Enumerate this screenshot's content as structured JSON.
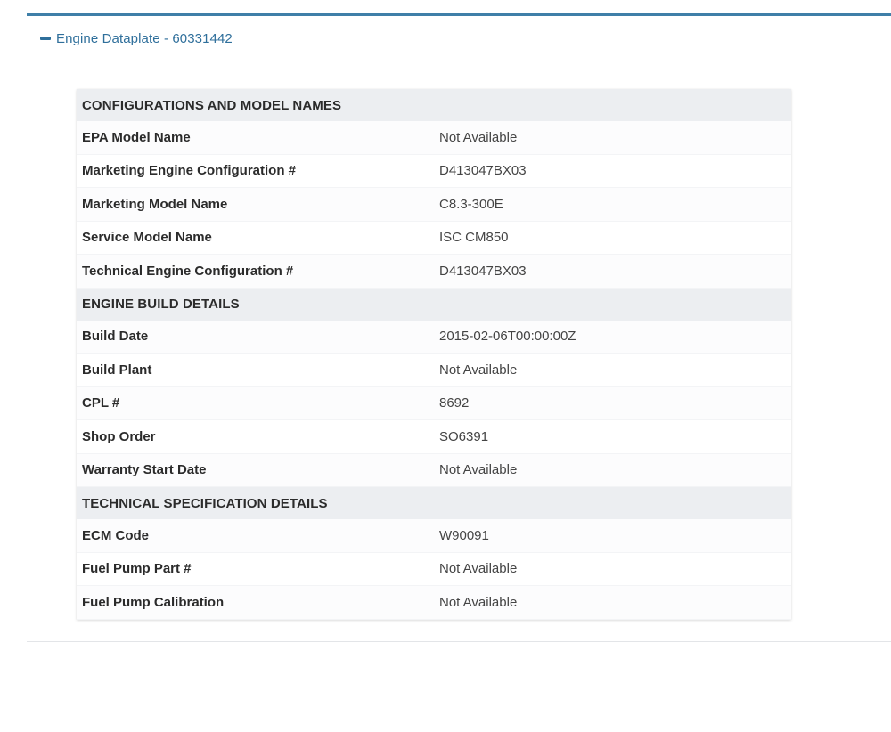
{
  "panel": {
    "title": "Engine Dataplate - 60331442",
    "collapse_icon": "minus-icon"
  },
  "colors": {
    "accent": "#3f7fa8",
    "link": "#2f6f9b",
    "section_bg": "#eceef1"
  },
  "sections": [
    {
      "title": "CONFIGURATIONS AND MODEL NAMES",
      "rows": [
        {
          "label": "EPA Model Name",
          "value": "Not Available"
        },
        {
          "label": "Marketing Engine Configuration #",
          "value": "D413047BX03"
        },
        {
          "label": "Marketing Model Name",
          "value": "C8.3-300E"
        },
        {
          "label": "Service Model Name",
          "value": "ISC CM850"
        },
        {
          "label": "Technical Engine Configuration #",
          "value": "D413047BX03"
        }
      ]
    },
    {
      "title": "ENGINE BUILD DETAILS",
      "rows": [
        {
          "label": "Build Date",
          "value": "2015-02-06T00:00:00Z"
        },
        {
          "label": "Build Plant",
          "value": "Not Available"
        },
        {
          "label": "CPL #",
          "value": "8692"
        },
        {
          "label": "Shop Order",
          "value": "SO6391"
        },
        {
          "label": "Warranty Start Date",
          "value": "Not Available"
        }
      ]
    },
    {
      "title": "TECHNICAL SPECIFICATION DETAILS",
      "rows": [
        {
          "label": "ECM Code",
          "value": "W90091"
        },
        {
          "label": "Fuel Pump Part #",
          "value": "Not Available"
        },
        {
          "label": "Fuel Pump Calibration",
          "value": "Not Available"
        }
      ]
    }
  ]
}
